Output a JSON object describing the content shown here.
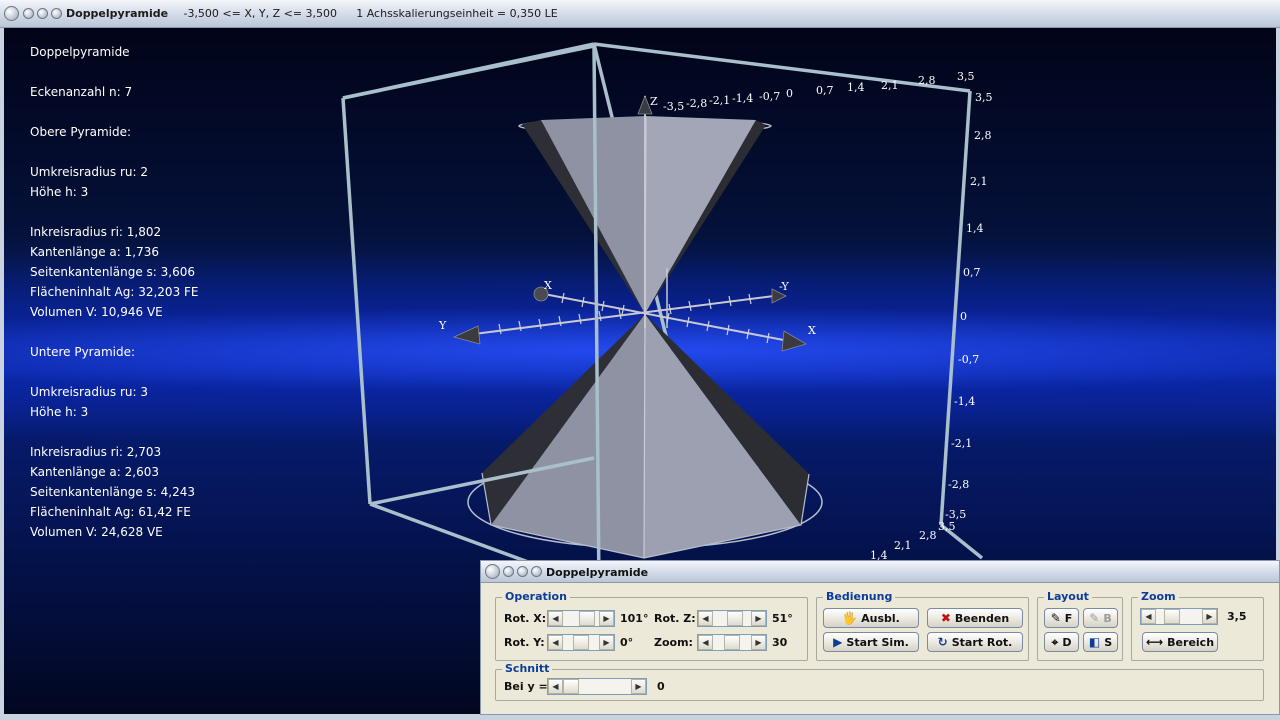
{
  "window": {
    "title": "Doppelpyramide",
    "range_info": "-3,500 <= X, Y, Z <= 3,500",
    "scale_info": "1 Achsskalierungseinheit = 0,350 LE"
  },
  "info": {
    "heading": "Doppelpyramide",
    "corner_count": "Eckenanzahl n: 7",
    "upper_heading": "Obere Pyramide:",
    "upper_ru": "Umkreisradius ru: 2",
    "upper_h": "Höhe h: 3",
    "upper_ri": "Inkreisradius ri: 1,802",
    "upper_a": "Kantenlänge a: 1,736",
    "upper_s": "Seitenkantenlänge s: 3,606",
    "upper_ag": "Flächeninhalt Ag: 32,203 FE",
    "upper_v": "Volumen V: 10,946 VE",
    "lower_heading": "Untere Pyramide:",
    "lower_ru": "Umkreisradius ru: 3",
    "lower_h": "Höhe h: 3",
    "lower_ri": "Inkreisradius ri: 2,703",
    "lower_a": "Kantenlänge a: 2,603",
    "lower_s": "Seitenkantenlänge s: 4,243",
    "lower_ag": "Flächeninhalt Ag: 61,42 FE",
    "lower_v": "Volumen V: 24,628 VE"
  },
  "axes": {
    "x_label": "X",
    "neg_x_label": "-X",
    "y_label": "Y",
    "neg_y_label": "-Y",
    "z_label": "Z",
    "top_ticks": [
      "-3,5",
      "-2,8",
      "-2,1",
      "-1,4",
      "-0,7",
      "0",
      "0,7",
      "1,4",
      "2,1",
      "2,8",
      "3,5"
    ],
    "right_ticks": [
      "3,5",
      "2,8",
      "2,1",
      "1,4",
      "0,7",
      "0",
      "-0,7",
      "-1,4",
      "-2,1",
      "-2,8",
      "-3,5"
    ],
    "bottom_ticks": [
      "3,5",
      "2,8",
      "2,1",
      "1,4"
    ]
  },
  "dialog": {
    "title": "Doppelpyramide",
    "operation": {
      "title": "Operation",
      "rot_x_label": "Rot. X:",
      "rot_x_value": "101°",
      "rot_x_level": 0.78,
      "rot_z_label": "Rot. Z:",
      "rot_z_value": "51°",
      "rot_z_level": 0.64,
      "rot_y_label": "Rot. Y:",
      "rot_y_value": "0°",
      "rot_y_level": 0.5,
      "zoom_label": "Zoom:",
      "zoom_value": "30",
      "zoom_level": 0.5
    },
    "schnitt": {
      "title": "Schnitt",
      "label": "Bei y =",
      "value": "0",
      "level": 0.0
    },
    "bedienung": {
      "title": "Bedienung",
      "ausbl": "Ausbl.",
      "beenden": "Beenden",
      "start_sim": "Start Sim.",
      "start_rot": "Start Rot."
    },
    "layout": {
      "title": "Layout",
      "f": "F",
      "b": "B",
      "d": "D",
      "s": "S"
    },
    "zoom": {
      "title": "Zoom",
      "value": "3,5",
      "level": 0.25,
      "bereich": "Bereich"
    }
  },
  "colors": {
    "pyramid_face": "#9a9cab",
    "pyramid_dark": "#2e2f36",
    "cube_edge": "#a9bfcc",
    "accent": "#0b3c9c"
  }
}
